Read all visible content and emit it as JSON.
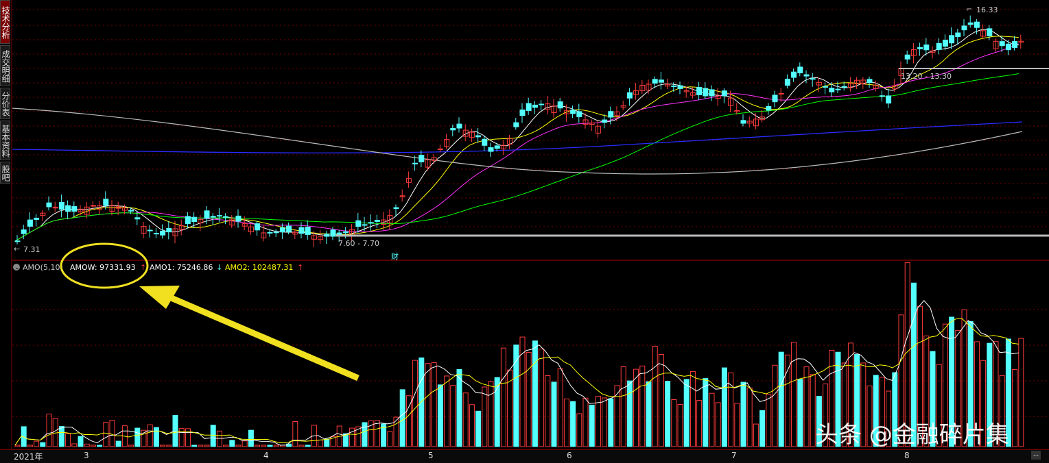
{
  "sidebar": {
    "tabs": [
      {
        "label": "技术分析",
        "active": true
      },
      {
        "label": "成交明细",
        "active": false
      },
      {
        "label": "分价表",
        "active": false
      },
      {
        "label": "基本资料",
        "active": false
      },
      {
        "label": "股吧",
        "active": false
      }
    ]
  },
  "price_chart": {
    "low_label": "7.31",
    "high_label": "16.33",
    "range_low_label": "7.60 - 7.70",
    "range_high_label": "13.20 - 13.30",
    "event_label": "财"
  },
  "indicator": {
    "name": "AMO(5,10)",
    "amow_label": "AMOW: 97331.93",
    "amow_arrow": "↑",
    "amo1_label": "AMO1: 75246.86",
    "amo1_arrow": "↓",
    "amo2_label": "AMO2: 102487.31",
    "amo2_arrow": "↑"
  },
  "time_axis": {
    "labels": [
      "2021年",
      "3",
      "4",
      "5",
      "6",
      "7",
      "8"
    ],
    "corner": "--"
  },
  "watermark": "头条 @金融碎片集",
  "colors": {
    "up": "#ff3c3c",
    "down": "#54ffff",
    "ma5": "#ffffff",
    "ma10": "#ffff00",
    "ma20": "#ff33ff",
    "ma60": "#00ff00",
    "ma120": "#2b2bff",
    "ma250": "#bbbbbb",
    "grid": "#7a0000",
    "annotation": "#f0e020"
  }
}
